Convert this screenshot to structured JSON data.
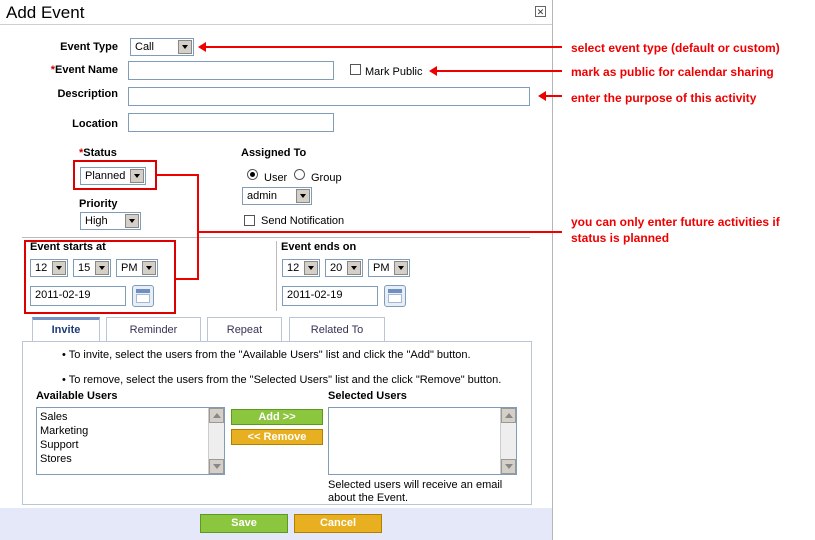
{
  "dialog": {
    "title": "Add Event",
    "close_glyph": "✕"
  },
  "form": {
    "event_type_label": "Event Type",
    "event_type_value": "Call",
    "event_name_req": "*",
    "event_name_label": "Event Name",
    "mark_public_label": "Mark Public",
    "description_label": "Description",
    "location_label": "Location",
    "status_req": "*",
    "status_label": "Status",
    "status_value": "Planned",
    "priority_label": "Priority",
    "priority_value": "High",
    "assigned_to_label": "Assigned To",
    "user_label": "User",
    "group_label": "Group",
    "assignee_value": "admin",
    "send_notification_label": "Send Notification",
    "starts_label": "Event starts at",
    "start_hour": "12",
    "start_min": "15",
    "start_ampm": "PM",
    "start_date": "2011-02-19",
    "ends_label": "Event ends on",
    "end_hour": "12",
    "end_min": "20",
    "end_ampm": "PM",
    "end_date": "2011-02-19"
  },
  "tabs": [
    "Invite",
    "Reminder",
    "Repeat",
    "Related To"
  ],
  "invite": {
    "bullet1": "To invite, select the users from the \"Available Users\" list and click the \"Add\" button.",
    "bullet2": "To remove, select the users from the \"Selected Users\" list and the click \"Remove\" button.",
    "available_label": "Available Users",
    "available_users": [
      "Sales",
      "Marketing",
      "Support",
      "Stores"
    ],
    "add_label": "Add >>",
    "remove_label": "<< Remove",
    "selected_label": "Selected Users",
    "note": "Selected users will receive an email about the Event."
  },
  "footer": {
    "save_label": "Save",
    "cancel_label": "Cancel"
  },
  "annotations": {
    "a1": "select event type (default or custom)",
    "a2": "mark as public for calendar sharing",
    "a3": "enter the purpose of this activity",
    "a4_line1": "you can only enter future activities if",
    "a4_line2": "status is planned"
  },
  "colors": {
    "annotation": "#e00000",
    "save": "#8cc63f",
    "cancel": "#e8b020",
    "footer_bg": "#e4e8f8"
  }
}
